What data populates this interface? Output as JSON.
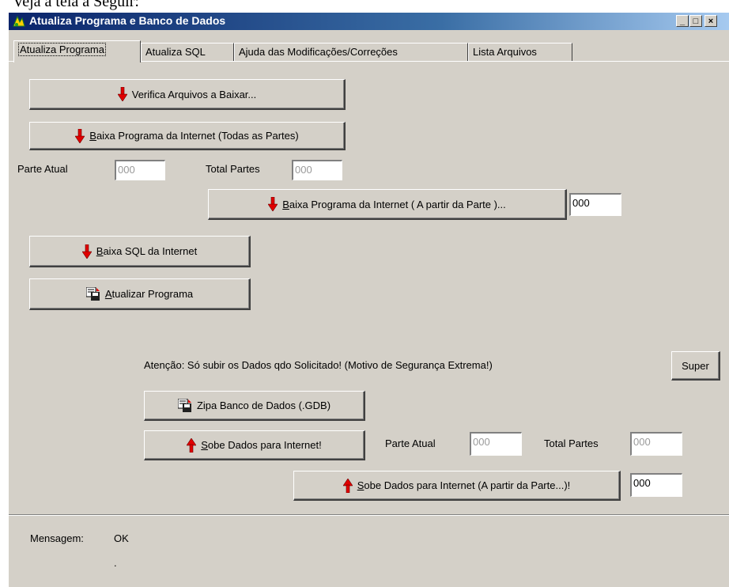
{
  "document": {
    "caption": "Veja a tela a Seguir:"
  },
  "window": {
    "title": "Atualiza Programa e Banco de Dados",
    "minimize_glyph": "_",
    "maximize_glyph": "□",
    "close_glyph": "×"
  },
  "tabs": [
    {
      "label": "Atualiza Programa",
      "active": true
    },
    {
      "label": "Atualiza SQL"
    },
    {
      "label": "Ajuda das Modificações/Correções"
    },
    {
      "label": "Lista Arquivos"
    }
  ],
  "buttons": {
    "verifica": "Verifica Arquivos a Baixar...",
    "baixa_todas_u": "B",
    "baixa_todas_rest": "aixa Programa da Internet (Todas as Partes)",
    "baixa_parte_u": "B",
    "baixa_parte_rest": "aixa Programa da Internet ( A partir da Parte )...",
    "baixa_sql_u": "B",
    "baixa_sql_rest": "aixa SQL da Internet",
    "atualizar_u": "A",
    "atualizar_rest": "tualizar Programa",
    "super": "Super",
    "zipa": "Zipa Banco de Dados (.GDB)",
    "sobe_u": "S",
    "sobe_rest": "obe Dados para Internet!",
    "sobe_parte_u": "S",
    "sobe_parte_rest": "obe Dados para Internet (A partir da Parte...)!"
  },
  "download": {
    "parte_atual_label": "Parte Atual",
    "parte_atual_value": "000",
    "total_partes_label": "Total Partes",
    "total_partes_value": "000",
    "start_part_value": "000"
  },
  "upload": {
    "warning": "Atenção: Só subir os Dados qdo Solicitado! (Motivo de Segurança Extrema!)",
    "parte_atual_label": "Parte Atual",
    "parte_atual_value": "000",
    "total_partes_label": "Total Partes",
    "total_partes_value": "000",
    "start_part_value": "000"
  },
  "status": {
    "label": "Mensagem:",
    "value": "OK",
    "dot": "."
  },
  "icons": {
    "down_arrow": "down-arrow-icon",
    "up_arrow": "up-arrow-icon",
    "save_disk": "save-disk-icon",
    "arrow_color": "#e00000"
  }
}
